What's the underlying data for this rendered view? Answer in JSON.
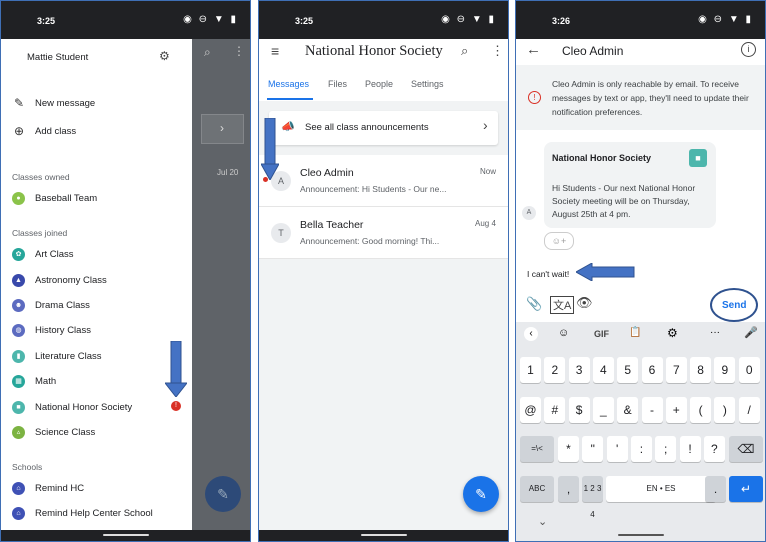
{
  "status": {
    "p1_time": "3:25",
    "p2_time": "3:25",
    "p3_time": "3:26",
    "icons": "◉ ⊖ ▼ ▮"
  },
  "drawer": {
    "user_name": "Mattie Student",
    "actions": [
      {
        "label": "New message",
        "icon": "compose-icon"
      },
      {
        "label": "Add class",
        "icon": "plus-circle-icon"
      }
    ],
    "sections": {
      "owned": "Classes owned",
      "joined": "Classes joined",
      "schools": "Schools"
    },
    "owned": [
      {
        "label": "Baseball Team",
        "color": "#8bc34a"
      }
    ],
    "joined": [
      {
        "label": "Art Class",
        "color": "#26a69a"
      },
      {
        "label": "Astronomy Class",
        "color": "#3949ab"
      },
      {
        "label": "Drama Class",
        "color": "#5c6bc0"
      },
      {
        "label": "History Class",
        "color": "#5c6bc0"
      },
      {
        "label": "Literature Class",
        "color": "#4db6ac"
      },
      {
        "label": "Math",
        "color": "#26a69a"
      },
      {
        "label": "National Honor Society",
        "color": "#4db6ac"
      },
      {
        "label": "Science Class",
        "color": "#7cb342"
      }
    ],
    "schools": [
      {
        "label": "Remind HC",
        "color": "#3f51b5"
      },
      {
        "label": "Remind Help Center School",
        "color": "#3f51b5"
      }
    ],
    "badge": "!",
    "bg_date": "Jul 20"
  },
  "class_screen": {
    "title": "National Honor Society",
    "tabs": [
      "Messages",
      "Files",
      "People",
      "Settings"
    ],
    "announcement_link": "See all class announcements",
    "messages": [
      {
        "initial": "A",
        "sender": "Cleo Admin",
        "time": "Now",
        "preview": "Announcement: Hi Students - Our ne..."
      },
      {
        "initial": "T",
        "sender": "Bella Teacher",
        "time": "Aug 4",
        "preview": "Announcement: Good morning! Thi..."
      }
    ]
  },
  "chat": {
    "title": "Cleo Admin",
    "banner": "Cleo Admin is only reachable by email. To receive messages by text or app, they'll need to update their notification preferences.",
    "class_name": "National Honor Society",
    "message": "Hi Students - Our next National Honor Society meeting will be on Thursday, August 25th at 4 pm.",
    "sender_initial": "A",
    "draft": "I can't wait!",
    "send_label": "Send"
  },
  "keyboard": {
    "toolbar": [
      "‹",
      "☺",
      "GIF",
      "📋",
      "⚙",
      "···",
      "🎤"
    ],
    "row1": [
      "1",
      "2",
      "3",
      "4",
      "5",
      "6",
      "7",
      "8",
      "9",
      "0"
    ],
    "row2": [
      "@",
      "#",
      "$",
      "_",
      "&",
      "-",
      "+",
      "(",
      ")",
      "/"
    ],
    "row3": [
      "=\\<",
      "*",
      "\"",
      "'",
      ":",
      ";",
      "!",
      "?",
      "⌫"
    ],
    "row4": [
      "ABC",
      ",",
      "1 2\n3 4",
      "EN • ES",
      ".",
      "↵"
    ],
    "hide": "⌄"
  },
  "colors": {
    "accent": "#1a73e8",
    "arrow": "#4472c4",
    "badge": "#d93025"
  }
}
